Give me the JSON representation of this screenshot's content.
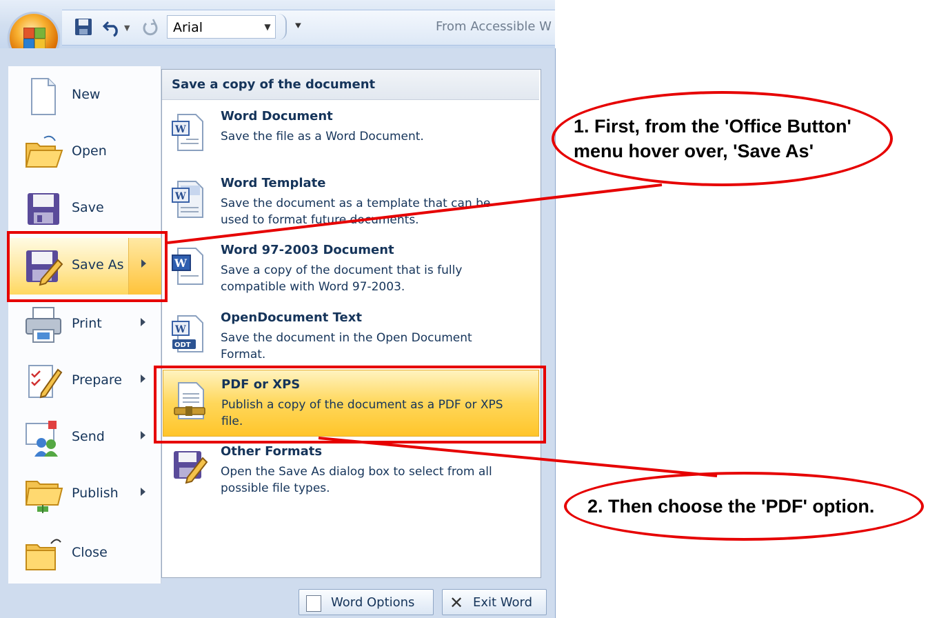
{
  "quick_access": {
    "font_name": "Arial",
    "title_text": "From Accessible W"
  },
  "menu": {
    "items": [
      {
        "label": "New",
        "key": "N"
      },
      {
        "label": "Open",
        "key": "O"
      },
      {
        "label": "Save",
        "key": "S"
      },
      {
        "label": "Save As",
        "key": "A"
      },
      {
        "label": "Print",
        "key": "P"
      },
      {
        "label": "Prepare",
        "key": "E"
      },
      {
        "label": "Send",
        "key": "D"
      },
      {
        "label": "Publish",
        "key": "U"
      },
      {
        "label": "Close",
        "key": "C"
      }
    ],
    "selected": "Save As"
  },
  "save_as_panel": {
    "header": "Save a copy of the document",
    "options": [
      {
        "title": "Word Document",
        "description": "Save the file as a Word Document."
      },
      {
        "title": "Word Template",
        "description": "Save the document as a template that can be used to format future documents."
      },
      {
        "title": "Word 97-2003 Document",
        "description": "Save a copy of the document that is fully compatible with Word 97-2003."
      },
      {
        "title": "OpenDocument Text",
        "description": "Save the document in the Open Document Format."
      },
      {
        "title": "PDF or XPS",
        "description": "Publish a copy of the document as a PDF or XPS file."
      },
      {
        "title": "Other Formats",
        "description": "Open the Save As dialog box to select from all possible file types."
      }
    ],
    "highlighted": "PDF or XPS"
  },
  "footer": {
    "word_options": "Word Options",
    "exit_word": "Exit Word"
  },
  "annotations": {
    "step1_line1": "1. First, from the 'Office Button'",
    "step1_line2": "menu hover over, 'Save As'",
    "step2": "2. Then choose the 'PDF' option."
  },
  "icons": {
    "office_button": "office-logo-icon",
    "qat_save": "floppy-disk-icon",
    "qat_undo": "undo-icon",
    "qat_redo": "redo-icon",
    "qat_customize": "customize-arrow-icon"
  },
  "colors": {
    "annotation_red": "#e60000",
    "highlight_gold": "#ffd75a",
    "text_navy": "#15345a"
  }
}
